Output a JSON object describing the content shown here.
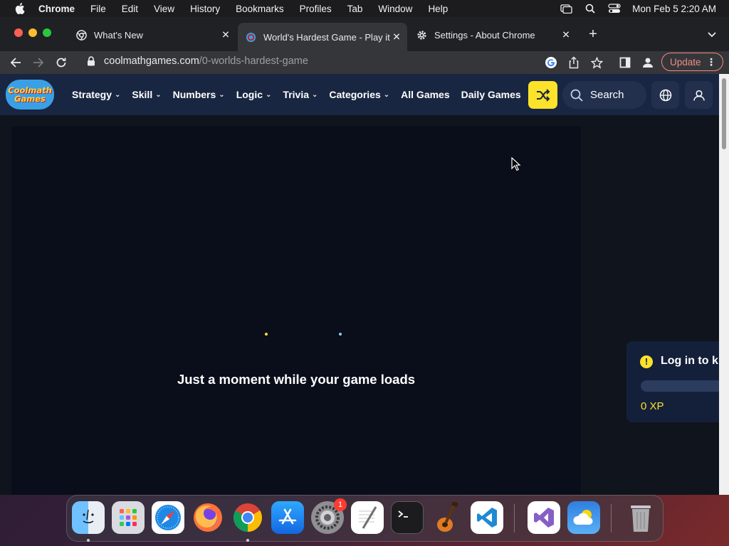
{
  "menubar": {
    "app": "Chrome",
    "items": [
      "File",
      "Edit",
      "View",
      "History",
      "Bookmarks",
      "Profiles",
      "Tab",
      "Window",
      "Help"
    ],
    "clock": "Mon Feb 5  2:20 AM"
  },
  "tabs": [
    {
      "title": "What's New",
      "active": false
    },
    {
      "title": "World's Hardest Game - Play it",
      "active": true
    },
    {
      "title": "Settings - About Chrome",
      "active": false
    }
  ],
  "omnibox": {
    "host": "coolmathgames.com",
    "path": "/0-worlds-hardest-game"
  },
  "toolbar": {
    "update_label": "Update"
  },
  "site": {
    "logo_line1": "Coolmath",
    "logo_line2": "Games",
    "nav": [
      {
        "label": "Strategy",
        "dropdown": true
      },
      {
        "label": "Skill",
        "dropdown": true
      },
      {
        "label": "Numbers",
        "dropdown": true
      },
      {
        "label": "Logic",
        "dropdown": true
      },
      {
        "label": "Trivia",
        "dropdown": true
      },
      {
        "label": "Categories",
        "dropdown": true
      },
      {
        "label": "All Games",
        "dropdown": false
      },
      {
        "label": "Daily Games",
        "dropdown": false
      }
    ],
    "search_label": "Search",
    "loading_text": "Just a moment while your game loads",
    "side_card": {
      "title": "Log in to k",
      "xp": "0 XP"
    }
  },
  "dock": {
    "apps": [
      "Finder",
      "Launchpad",
      "Safari",
      "Firefox",
      "Google Chrome",
      "App Store",
      "System Settings",
      "TextEdit",
      "Terminal",
      "GarageBand",
      "Visual Studio Code",
      "Visual Studio",
      "Weather",
      "Trash"
    ],
    "system_settings_badge": "1"
  },
  "colors": {
    "accent_yellow": "#fce22a",
    "nav_bg": "#192642",
    "game_bg": "#090e1a",
    "update_red": "#f28b82"
  }
}
